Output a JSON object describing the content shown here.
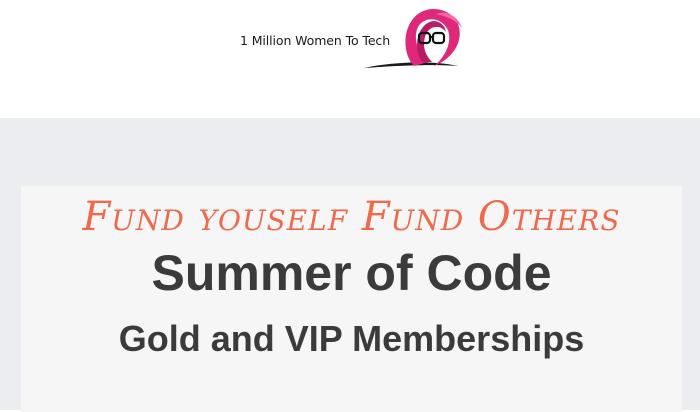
{
  "header": {
    "logo_text": "1 Million Women To Tech"
  },
  "hero": {
    "tagline": "Fund youself Fund Others",
    "title": "Summer of Code",
    "subtitle": "Gold and VIP Memberships"
  },
  "colors": {
    "tagline": "#f0694a",
    "title": "#3b3b3b",
    "logo_hair": "#e0287a",
    "background": "#ecedf0",
    "card": "#f6f6f7"
  }
}
